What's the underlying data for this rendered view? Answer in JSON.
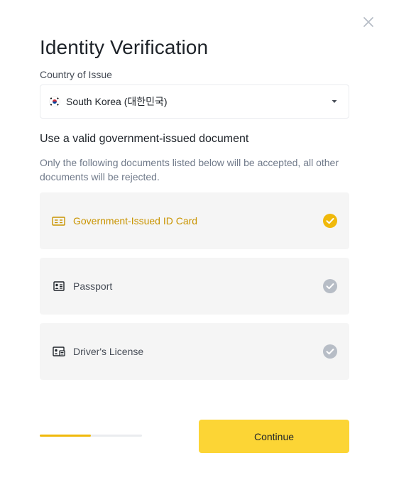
{
  "modal": {
    "title": "Identity Verification",
    "close_icon": "close-icon"
  },
  "country": {
    "label": "Country of Issue",
    "selected": "South Korea (대한민국)",
    "flag_icon": "south-korea-flag-icon"
  },
  "documents": {
    "heading": "Use a valid government-issued document",
    "description": "Only the following documents listed below will be accepted, all other documents will be rejected.",
    "options": [
      {
        "label": "Government-Issued ID Card",
        "icon": "id-card-icon",
        "selected": true
      },
      {
        "label": "Passport",
        "icon": "passport-icon",
        "selected": false
      },
      {
        "label": "Driver's License",
        "icon": "drivers-license-icon",
        "selected": false
      }
    ]
  },
  "footer": {
    "progress": 0.5,
    "continue_label": "Continue"
  },
  "colors": {
    "accent": "#fcd535",
    "accent_text": "#c99400",
    "check_selected": "#f0b90b",
    "check_unselected": "#b7bdc6",
    "option_bg": "#f5f5f5"
  }
}
